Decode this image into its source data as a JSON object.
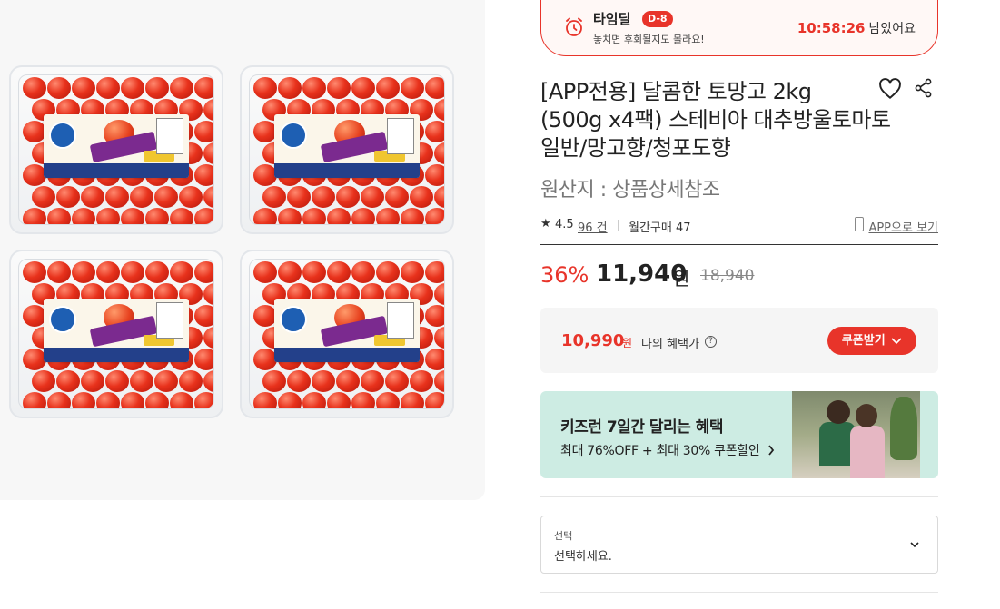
{
  "time_deal": {
    "title": "타임딜",
    "badge": "D-8",
    "subtitle": "놓치면 후회될지도 몰라요!",
    "countdown": "10:58:26",
    "countdown_suffix": "남았어요"
  },
  "product": {
    "title_lines": [
      "[APP전용] 달콤한 토망고 2kg",
      "(500g x4팩) 스테비아 대추방울토마토",
      "일반/망고향/청포도향"
    ],
    "origin": "원산지 : 상품상세참조",
    "rating": "4.5",
    "reviews": "96 건",
    "monthly_purchases": "월간구매 47",
    "app_link": "APP으로 보기"
  },
  "price": {
    "discount": "36%",
    "sale_price": "11,940",
    "currency": "원",
    "original_price": "18,940"
  },
  "benefit": {
    "price": "10,990",
    "currency": "원",
    "label": "나의 혜택가",
    "help_icon": "?",
    "coupon_button": "쿠폰받기"
  },
  "banner": {
    "title": "키즈런 7일간 달리는 혜택",
    "subtitle": "최대 76%OFF + 최대 30% 쿠폰할인"
  },
  "option_select": {
    "label": "선택",
    "value": "선택하세요."
  },
  "icons": {
    "alarm": "alarm-clock-icon",
    "heart": "heart-icon",
    "share": "share-icon",
    "star": "star-icon",
    "phone": "smartphone-icon",
    "chevron": "chevron-down-icon"
  },
  "colors": {
    "accent": "#e8342a",
    "banner_bg": "#cdece3",
    "benefit_bg": "#f5f5f5"
  }
}
